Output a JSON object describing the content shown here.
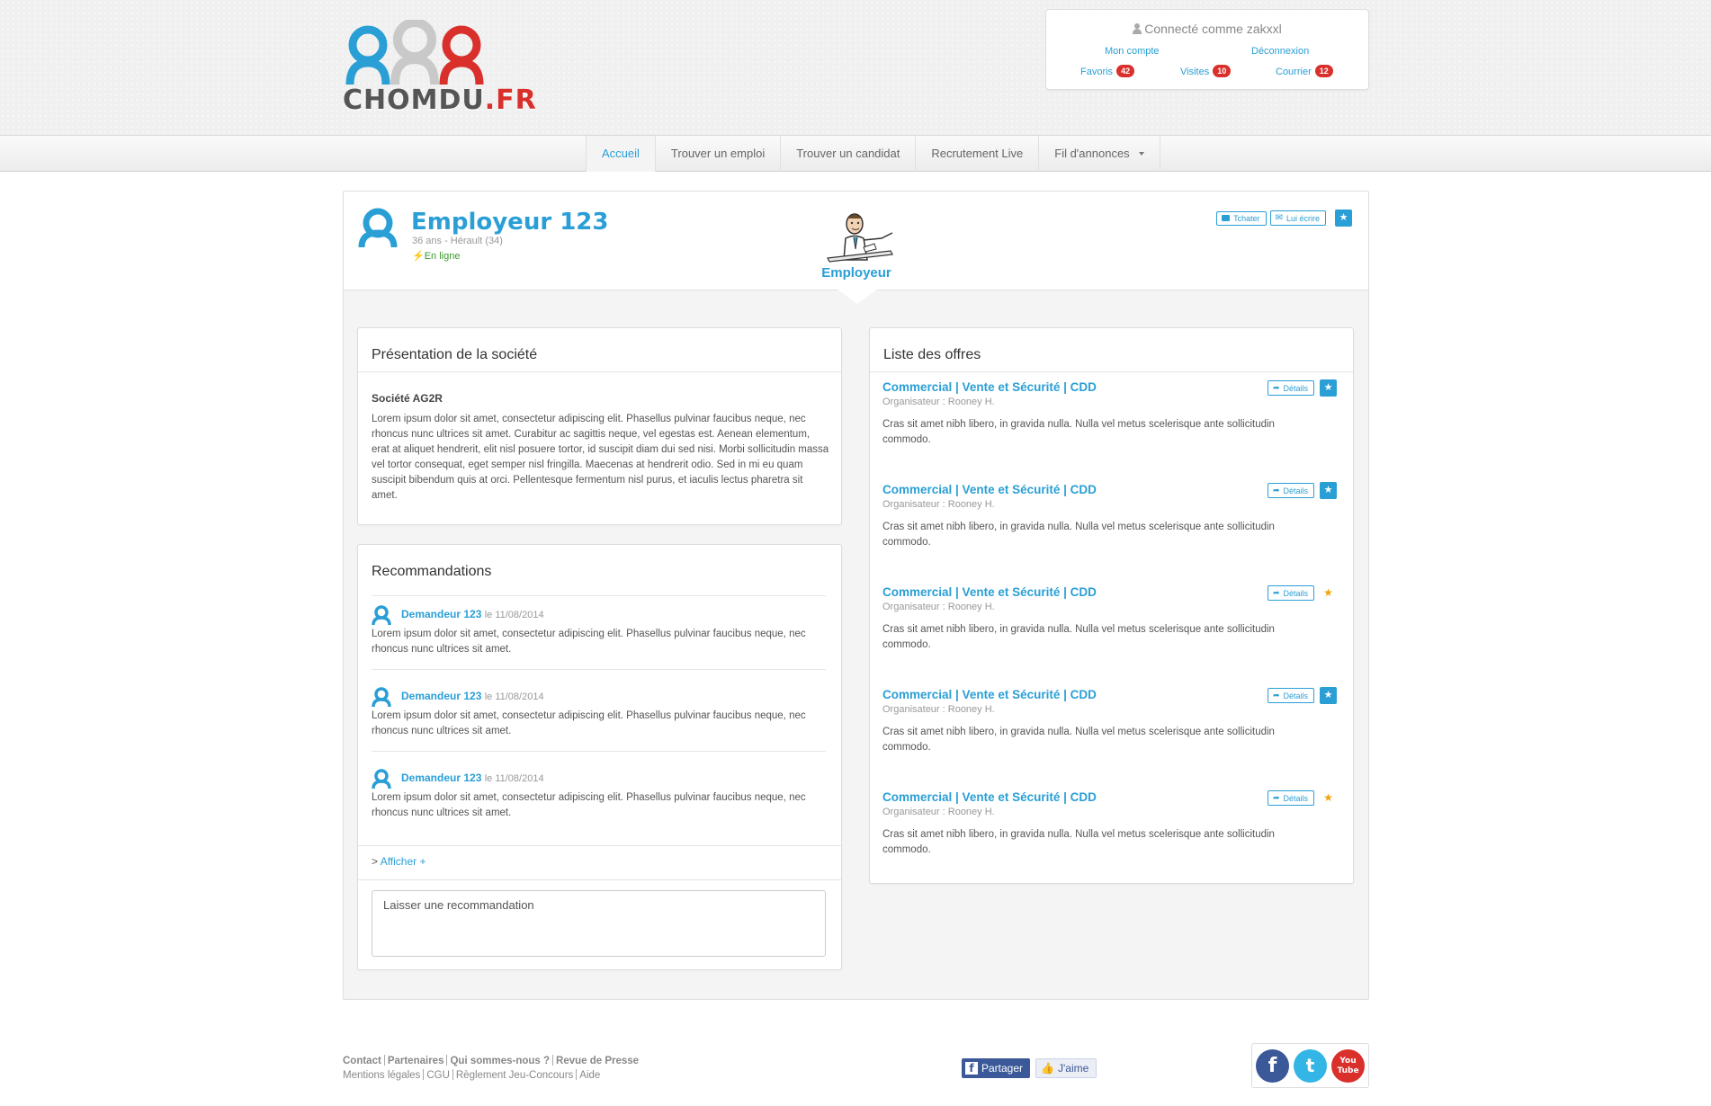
{
  "brand": {
    "logo_main": "CHOMDU",
    "logo_tld": ".FR",
    "colors": {
      "blue": "#2a9fd6",
      "red": "#d9302c",
      "grey": "#c9c9c9"
    }
  },
  "user_box": {
    "connected_label": "Connecté comme zakxxl",
    "my_account": "Mon compte",
    "logout": "Déconnexion",
    "favorites": {
      "label": "Favoris",
      "count": "42"
    },
    "visits": {
      "label": "Visites",
      "count": "10"
    },
    "mail": {
      "label": "Courrier",
      "count": "12"
    }
  },
  "nav": {
    "items": [
      {
        "label": "Accueil",
        "active": true
      },
      {
        "label": "Trouver un emploi"
      },
      {
        "label": "Trouver un candidat"
      },
      {
        "label": "Recrutement Live"
      },
      {
        "label": "Fil d'annonces"
      }
    ]
  },
  "profile": {
    "name": "Employeur 123",
    "subtitle": "36 ans - Hérault (34)",
    "status": "En ligne",
    "role": "Employeur",
    "chat_label": "Tchater",
    "write_label": "Lui écrire",
    "star": "★"
  },
  "company": {
    "title": "Présentation de la société",
    "name": "Société AG2R",
    "description": "Lorem ipsum dolor sit amet, consectetur adipiscing elit. Phasellus pulvinar faucibus neque, nec rhoncus nunc ultrices sit amet. Curabitur ac sagittis neque, vel egestas est. Aenean elementum, erat at aliquet hendrerit, elit nisl posuere tortor, id suscipit diam dui sed nisi. Morbi sollicitudin massa vel tortor consequat, eget semper nisl fringilla. Maecenas at hendrerit odio. Sed in mi eu quam suscipit bibendum quis at orci. Pellentesque fermentum nisl purus, et iaculis lectus pharetra sit amet."
  },
  "recommendations": {
    "title": "Recommandations",
    "items": [
      {
        "author": "Demandeur 123",
        "date": "le 11/08/2014",
        "text": "Lorem ipsum dolor sit amet, consectetur adipiscing elit. Phasellus pulvinar faucibus neque, nec rhoncus nunc ultrices sit amet."
      },
      {
        "author": "Demandeur 123",
        "date": "le 11/08/2014",
        "text": "Lorem ipsum dolor sit amet, consectetur adipiscing elit. Phasellus pulvinar faucibus neque, nec rhoncus nunc ultrices sit amet."
      },
      {
        "author": "Demandeur 123",
        "date": "le 11/08/2014",
        "text": "Lorem ipsum dolor sit amet, consectetur adipiscing elit. Phasellus pulvinar faucibus neque, nec rhoncus nunc ultrices sit amet."
      }
    ],
    "show_more_prefix": ">",
    "show_more": "Afficher +",
    "input_placeholder": "Laisser une recommandation"
  },
  "offers": {
    "title": "Liste des offres",
    "details_label": "Détails",
    "items": [
      {
        "title": "Commercial | Vente et Sécurité | CDD",
        "organizer": "Organisateur : Rooney H.",
        "text": "Cras sit amet nibh libero, in gravida nulla. Nulla vel metus scelerisque ante sollicitudin commodo.",
        "favorited": true
      },
      {
        "title": "Commercial | Vente et Sécurité | CDD",
        "organizer": "Organisateur : Rooney H.",
        "text": "Cras sit amet nibh libero, in gravida nulla. Nulla vel metus scelerisque ante sollicitudin commodo.",
        "favorited": true
      },
      {
        "title": "Commercial | Vente et Sécurité | CDD",
        "organizer": "Organisateur : Rooney H.",
        "text": "Cras sit amet nibh libero, in gravida nulla. Nulla vel metus scelerisque ante sollicitudin commodo.",
        "favorited": false
      },
      {
        "title": "Commercial | Vente et Sécurité | CDD",
        "organizer": "Organisateur : Rooney H.",
        "text": "Cras sit amet nibh libero, in gravida nulla. Nulla vel metus scelerisque ante sollicitudin commodo.",
        "favorited": true
      },
      {
        "title": "Commercial | Vente et Sécurité | CDD",
        "organizer": "Organisateur : Rooney H.",
        "text": "Cras sit amet nibh libero, in gravida nulla. Nulla vel metus scelerisque ante sollicitudin commodo.",
        "favorited": false
      }
    ]
  },
  "footer": {
    "links_row1": [
      "Contact",
      "Partenaires",
      "Qui sommes-nous ?",
      "Revue de Presse"
    ],
    "links_row2": [
      "Mentions légales",
      "CGU",
      "Règlement Jeu-Concours",
      "Aide"
    ],
    "share_label": "Partager",
    "like_label": "J'aime",
    "social": {
      "facebook": "f",
      "twitter": "t",
      "youtube_top": "You",
      "youtube_bottom": "Tube"
    }
  }
}
